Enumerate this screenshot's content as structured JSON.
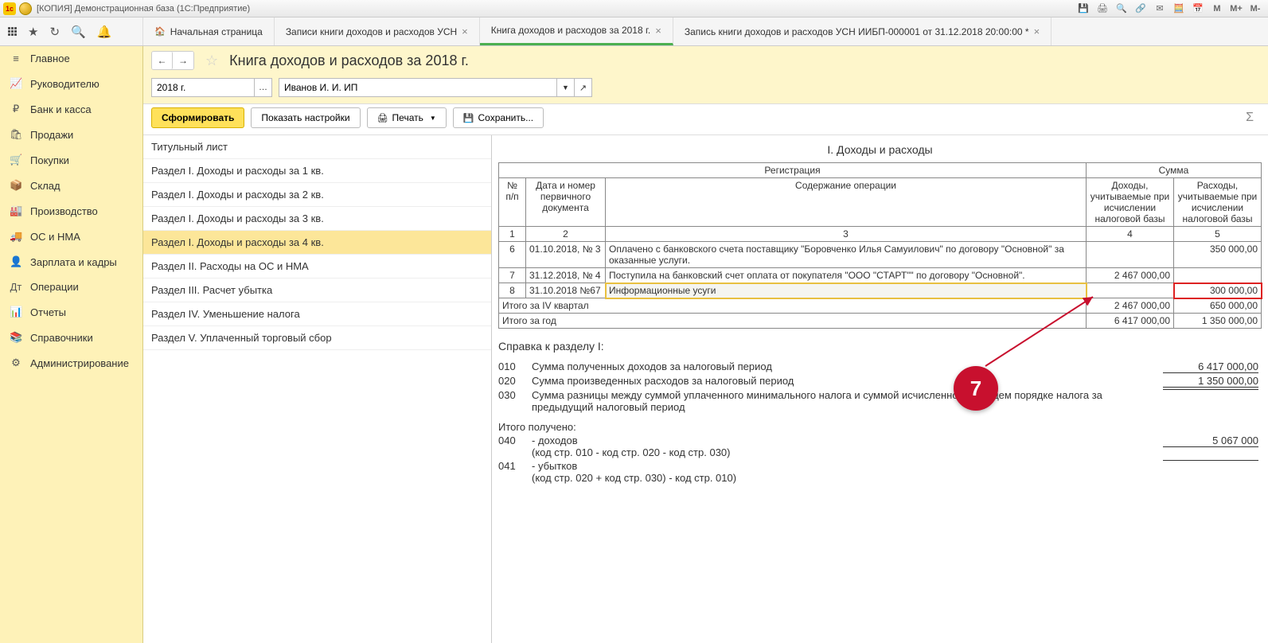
{
  "titlebar": {
    "text": "[КОПИЯ] Демонстрационная база  (1С:Предприятие)"
  },
  "tabs": [
    {
      "label": "Начальная страница",
      "home": true
    },
    {
      "label": "Записи книги доходов и расходов УСН",
      "closable": true
    },
    {
      "label": "Книга доходов и расходов за 2018 г.",
      "closable": true,
      "active": true
    },
    {
      "label": "Запись книги доходов и расходов УСН ИИБП-000001 от 31.12.2018 20:00:00 *",
      "closable": true
    }
  ],
  "sidebar": [
    {
      "icon": "≡",
      "label": "Главное"
    },
    {
      "icon": "📈",
      "label": "Руководителю"
    },
    {
      "icon": "₽",
      "label": "Банк и касса"
    },
    {
      "icon": "🛍",
      "label": "Продажи"
    },
    {
      "icon": "🛒",
      "label": "Покупки"
    },
    {
      "icon": "📦",
      "label": "Склад"
    },
    {
      "icon": "🏭",
      "label": "Производство"
    },
    {
      "icon": "🚚",
      "label": "ОС и НМА"
    },
    {
      "icon": "👤",
      "label": "Зарплата и кадры"
    },
    {
      "icon": "Дт",
      "label": "Операции"
    },
    {
      "icon": "📊",
      "label": "Отчеты"
    },
    {
      "icon": "📚",
      "label": "Справочники"
    },
    {
      "icon": "⚙",
      "label": "Администрирование"
    }
  ],
  "page": {
    "title": "Книга доходов и расходов за 2018 г.",
    "period": "2018 г.",
    "org": "Иванов И. И. ИП"
  },
  "actions": {
    "form": "Сформировать",
    "settings": "Показать настройки",
    "print": "Печать",
    "save": "Сохранить..."
  },
  "nav": [
    "Титульный лист",
    "Раздел I. Доходы и расходы за 1 кв.",
    "Раздел I. Доходы и расходы за 2 кв.",
    "Раздел I. Доходы и расходы за 3 кв.",
    "Раздел I. Доходы и расходы за 4 кв.",
    "Раздел II. Расходы на ОС и НМА",
    "Раздел III. Расчет убытка",
    "Раздел IV. Уменьшение налога",
    "Раздел V. Уплаченный торговый сбор"
  ],
  "report": {
    "heading": "I. Доходы и расходы",
    "h_reg": "Регистрация",
    "h_sum": "Сумма",
    "h_no": "№ п/п",
    "h_doc": "Дата и номер первичного документа",
    "h_op": "Содержание операции",
    "h_income": "Доходы, учитываемые при исчислении налоговой базы",
    "h_expense": "Расходы, учитываемые при исчислении налоговой базы",
    "cols": [
      "1",
      "2",
      "3",
      "4",
      "5"
    ],
    "rows": [
      {
        "n": "6",
        "doc": "01.10.2018, № 3",
        "op": "Оплачено с банковского счета поставщику \"Боровченко Илья Самуилович\" по договору \"Основной\" за оказанные услуги.",
        "income": "",
        "expense": "350 000,00"
      },
      {
        "n": "7",
        "doc": "31.12.2018, № 4",
        "op": "Поступила на банковский счет оплата от покупателя \"ООО \"СТАРТ\"\" по договору \"Основной\".",
        "income": "2 467 000,00",
        "expense": ""
      },
      {
        "n": "8",
        "doc": "31.10.2018 №67",
        "op": "Информационные усуги",
        "income": "",
        "expense": "300 000,00",
        "hl": true
      }
    ],
    "totals": [
      {
        "label": "Итого за IV квартал",
        "income": "2 467 000,00",
        "expense": "650 000,00"
      },
      {
        "label": "Итого за год",
        "income": "6 417 000,00",
        "expense": "1 350 000,00"
      }
    ]
  },
  "spravka": {
    "title": "Справка к разделу I:",
    "lines": [
      {
        "code": "010",
        "text": "Сумма полученных доходов за налоговый период",
        "val": "6 417 000,00"
      },
      {
        "code": "020",
        "text": "Сумма произведенных  расходов за налоговый период",
        "val": "1 350 000,00"
      },
      {
        "code": "030",
        "text": "Сумма разницы между  суммой уплаченного минимального налога и суммой исчисленного в общем порядке налога за предыдущий налоговый период",
        "val": ""
      }
    ],
    "itogo": "Итого получено:",
    "lines2": [
      {
        "code": "040",
        "text": "- доходов",
        "sub": "(код стр. 010 - код  стр. 020 - код стр. 030)",
        "val": "5 067 000"
      },
      {
        "code": "041",
        "text": "- убытков",
        "sub": "(код стр. 020 + код  стр. 030) - код стр. 010)",
        "val": ""
      }
    ]
  },
  "callout": "7"
}
